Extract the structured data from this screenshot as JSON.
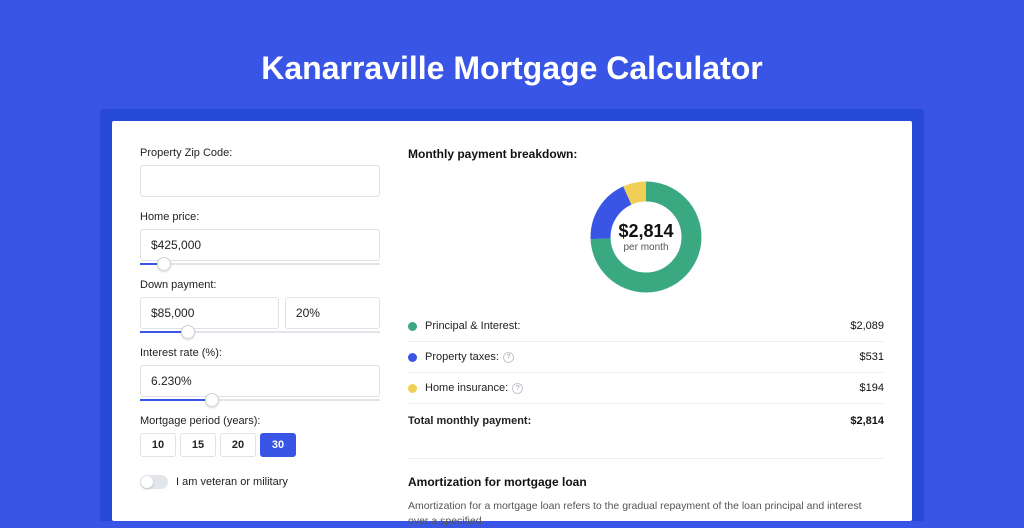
{
  "title": "Kanarraville Mortgage Calculator",
  "colors": {
    "accent": "#3855e5",
    "seriesPrincipal": "#3aa981",
    "seriesTaxes": "#3855e5",
    "seriesInsurance": "#f1cf56"
  },
  "form": {
    "zip": {
      "label": "Property Zip Code:",
      "value": ""
    },
    "homePrice": {
      "label": "Home price:",
      "value": "$425,000",
      "sliderPercent": 10
    },
    "downPayment": {
      "label": "Down payment:",
      "amount": "$85,000",
      "percent": "20%",
      "sliderPercent": 20
    },
    "interestRate": {
      "label": "Interest rate (%):",
      "value": "6.230%",
      "sliderPercent": 30
    },
    "period": {
      "label": "Mortgage period (years):",
      "options": [
        "10",
        "15",
        "20",
        "30"
      ],
      "selected": "30"
    },
    "veteran": {
      "label": "I am veteran or military",
      "value": false
    }
  },
  "breakdown": {
    "title": "Monthly payment breakdown:",
    "centerAmount": "$2,814",
    "centerSub": "per month",
    "items": [
      {
        "label": "Principal & Interest:",
        "value": "$2,089",
        "colorKey": "seriesPrincipal",
        "info": false
      },
      {
        "label": "Property taxes:",
        "value": "$531",
        "colorKey": "seriesTaxes",
        "info": true
      },
      {
        "label": "Home insurance:",
        "value": "$194",
        "colorKey": "seriesInsurance",
        "info": true
      }
    ],
    "totalLabel": "Total monthly payment:",
    "totalValue": "$2,814"
  },
  "amortization": {
    "title": "Amortization for mortgage loan",
    "text": "Amortization for a mortgage loan refers to the gradual repayment of the loan principal and interest over a specified"
  },
  "chart_data": {
    "type": "pie",
    "title": "Monthly payment breakdown",
    "series": [
      {
        "name": "Principal & Interest",
        "value": 2089
      },
      {
        "name": "Property taxes",
        "value": 531
      },
      {
        "name": "Home insurance",
        "value": 194
      }
    ],
    "total": 2814,
    "unit": "USD/month"
  }
}
